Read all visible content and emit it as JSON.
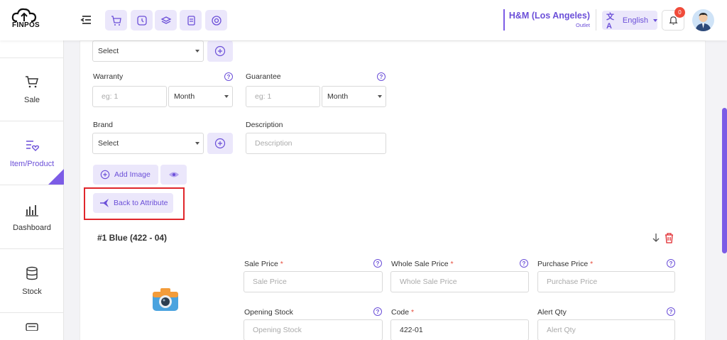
{
  "header": {
    "logo_text": "FINPOS",
    "store_name": "H&M (Los Angeles)",
    "store_type": "Outlet",
    "language": "English",
    "notification_count": "0",
    "tools": [
      "cart-icon",
      "clock-icon",
      "layers-icon",
      "receipt-icon",
      "support-icon"
    ]
  },
  "sidebar": {
    "items": [
      {
        "label": "Sale",
        "icon": "cart-icon"
      },
      {
        "label": "Item/Product",
        "icon": "product-list-icon"
      },
      {
        "label": "Dashboard",
        "icon": "chart-icon"
      },
      {
        "label": "Stock",
        "icon": "database-icon"
      }
    ]
  },
  "form": {
    "top_select": {
      "value": "Select"
    },
    "warranty": {
      "label": "Warranty",
      "placeholder": "eg: 1",
      "unit": "Month"
    },
    "guarantee": {
      "label": "Guarantee",
      "placeholder": "eg: 1",
      "unit": "Month"
    },
    "brand": {
      "label": "Brand",
      "value": "Select"
    },
    "description": {
      "label": "Description",
      "placeholder": "Description"
    },
    "add_image_label": "Add Image",
    "back_to_attribute_label": "Back to Attribute"
  },
  "variant": {
    "title": "#1 Blue (422 - 04)",
    "sale_price": {
      "label": "Sale Price",
      "placeholder": "Sale Price"
    },
    "whole_sale_price": {
      "label": "Whole Sale Price",
      "placeholder": "Whole Sale Price"
    },
    "purchase_price": {
      "label": "Purchase Price",
      "placeholder": "Purchase Price"
    },
    "opening_stock": {
      "label": "Opening Stock",
      "placeholder": "Opening Stock"
    },
    "code": {
      "label": "Code",
      "value": "422-01"
    },
    "alert_qty": {
      "label": "Alert Qty",
      "placeholder": "Alert Qty"
    }
  },
  "colors": {
    "accent": "#6b4fd8",
    "accent_light": "#ebe7fb",
    "danger": "#e0262b"
  }
}
